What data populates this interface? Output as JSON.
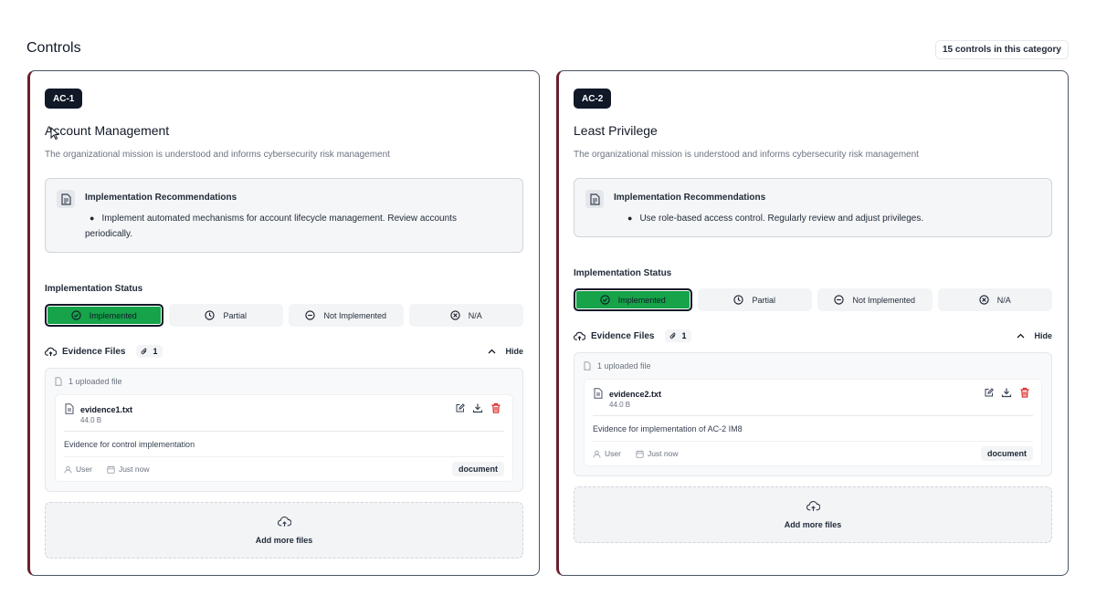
{
  "header": {
    "title": "Controls",
    "count_label": "15 controls in this category"
  },
  "controls": [
    {
      "id": "AC-1",
      "title": "Account Management",
      "description": "The organizational mission is understood and informs cybersecurity risk management",
      "recommendations_title": "Implementation Recommendations",
      "recommendation": "Implement automated mechanisms for account lifecycle management. Review accounts periodically.",
      "status_label": "Implementation Status",
      "status_options": [
        "Implemented",
        "Partial",
        "Not Implemented",
        "N/A"
      ],
      "selected_status": "Implemented",
      "evidence_title": "Evidence Files",
      "evidence_count": "1",
      "hide_label": "Hide",
      "uploaded_label": "1 uploaded file",
      "file": {
        "name": "evidence1.txt",
        "size": "44.0 B",
        "note": "Evidence for control implementation",
        "user": "User",
        "time": "Just now",
        "tag": "document"
      },
      "add_label": "Add more files"
    },
    {
      "id": "AC-2",
      "title": "Least Privilege",
      "description": "The organizational mission is understood and informs cybersecurity risk management",
      "recommendations_title": "Implementation Recommendations",
      "recommendation": "Use role-based access control. Regularly review and adjust privileges.",
      "status_label": "Implementation Status",
      "status_options": [
        "Implemented",
        "Partial",
        "Not Implemented",
        "N/A"
      ],
      "selected_status": "Implemented",
      "evidence_title": "Evidence Files",
      "evidence_count": "1",
      "hide_label": "Hide",
      "uploaded_label": "1 uploaded file",
      "file": {
        "name": "evidence2.txt",
        "size": "44.0 B",
        "note": "Evidence for implementation of AC-2 IM8",
        "user": "User",
        "time": "Just now",
        "tag": "document"
      },
      "add_label": "Add more files"
    }
  ],
  "colors": {
    "accent_border": "#6b1d2e",
    "implemented_green": "#16a34a",
    "delete_red": "#dc2626",
    "badge_dark": "#111827"
  },
  "icons": {
    "recommendation": "document-icon",
    "status": [
      "check-circle-icon",
      "clock-icon",
      "minus-circle-icon",
      "x-circle-icon"
    ],
    "evidence": "cloud-upload-icon",
    "count": "paperclip-icon",
    "hide": "chevron-up-icon",
    "file": "file-icon",
    "actions": [
      "edit-icon",
      "download-icon",
      "trash-icon"
    ],
    "meta": [
      "user-icon",
      "calendar-icon"
    ]
  }
}
